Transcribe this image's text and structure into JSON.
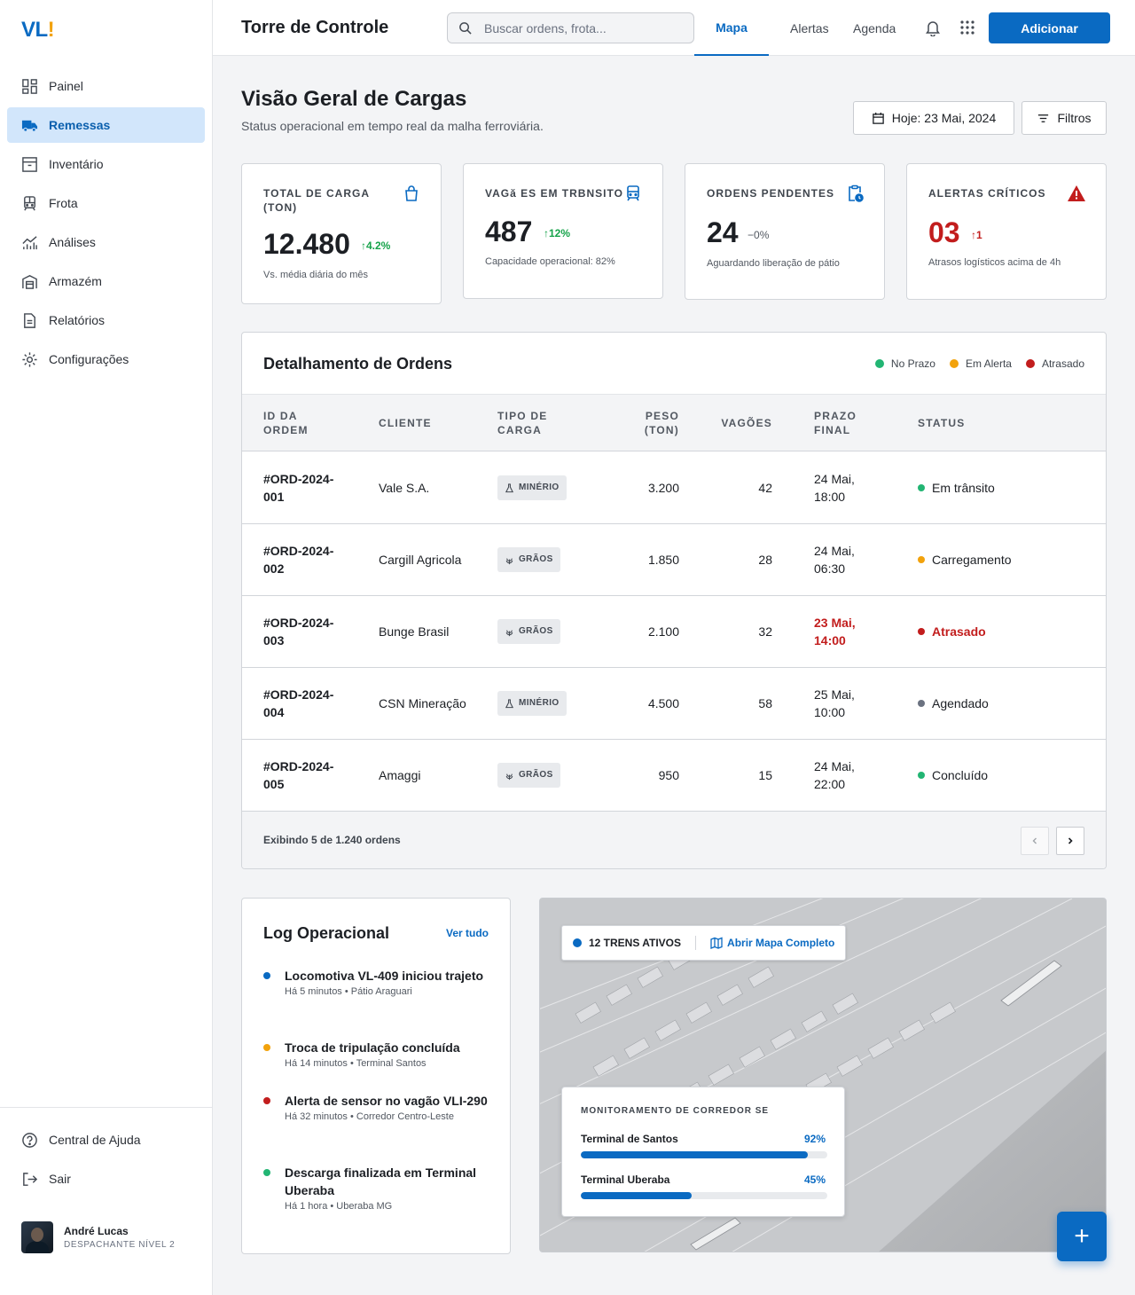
{
  "brand": {
    "logo_main": "VL",
    "logo_mark": "!"
  },
  "sidebar": {
    "items": [
      {
        "label": "Painel",
        "icon": "grid-icon",
        "active": false
      },
      {
        "label": "Remessas",
        "icon": "truck-icon",
        "active": true
      },
      {
        "label": "Inventário",
        "icon": "archive-icon",
        "active": false
      },
      {
        "label": "Frota",
        "icon": "train-icon",
        "active": false
      },
      {
        "label": "Análises",
        "icon": "analytics-icon",
        "active": false
      },
      {
        "label": "Armazém",
        "icon": "warehouse-icon",
        "active": false
      },
      {
        "label": "Relatórios",
        "icon": "report-icon",
        "active": false
      },
      {
        "label": "Configurações",
        "icon": "gear-icon",
        "active": false
      }
    ],
    "bottom": [
      {
        "label": "Central de Ajuda",
        "icon": "help-icon"
      },
      {
        "label": "Sair",
        "icon": "logout-icon"
      }
    ],
    "user": {
      "name": "André Lucas",
      "role": "DESPACHANTE NÍVEL 2"
    }
  },
  "header": {
    "title": "Torre de Controle",
    "search_placeholder": "Buscar ordens, frota...",
    "tabs": [
      {
        "label": "Mapa",
        "active": true
      },
      {
        "label": "Alertas",
        "active": false
      },
      {
        "label": "Agenda",
        "active": false
      }
    ],
    "add_label": "Adicionar"
  },
  "page": {
    "title": "Visão Geral de Cargas",
    "subtitle": "Status operacional em tempo real da malha ferroviária.",
    "date_label": "Hoje: 23 Mai, 2024",
    "filters_label": "Filtros"
  },
  "kpis": [
    {
      "label": "TOTAL DE CARGA (TON)",
      "value": "12.480",
      "delta": "4.2%",
      "delta_color": "#16a34a",
      "note": "Vs. média diária do mês",
      "icon": "bag-icon"
    },
    {
      "label": "VAGă ES EM TRBNSITO",
      "value": "487",
      "delta": "12%",
      "delta_color": "#16a34a",
      "note": "Capacidade operacional: 82%",
      "icon": "train-icon"
    },
    {
      "label": "ORDENS PENDENTES",
      "value": "24",
      "delta": "0%",
      "delta_color": "#525861",
      "note": "Aguardando liberação de pátio",
      "icon": "clipboard-clock-icon"
    },
    {
      "label": "ALERTAS CRÍTICOS",
      "value": "03",
      "delta": "1",
      "delta_color": "#c21d1d",
      "note": "Atrasos logísticos acima de 4h",
      "icon": "warning-icon"
    }
  ],
  "orders": {
    "title": "Detalhamento de Ordens",
    "legend": [
      {
        "label": "No Prazo",
        "color": "#22b573"
      },
      {
        "label": "Em Alerta",
        "color": "#f2a20c"
      },
      {
        "label": "Atrasado",
        "color": "#c21d1d"
      }
    ],
    "columns": [
      "ID DA ORDEM",
      "CLIENTE",
      "TIPO DE CARGA",
      "PESO (TON)",
      "VAGÕES",
      "PRAZO FINAL",
      "STATUS"
    ],
    "rows": [
      {
        "id": "#ORD-2024-001",
        "client": "Vale S.A.",
        "cargo": "MINÉRIO",
        "cargo_icon": "flask-icon",
        "weight": "3.200",
        "wagons": "42",
        "deadline": "24 Mai, 18:00",
        "late": false,
        "status": "Em trânsito",
        "status_color": "#22b573"
      },
      {
        "id": "#ORD-2024-002",
        "client": "Cargill Agricola",
        "cargo": "GRÃOS",
        "cargo_icon": "grain-icon",
        "weight": "1.850",
        "wagons": "28",
        "deadline": "24 Mai, 06:30",
        "late": false,
        "status": "Carregamento",
        "status_color": "#f2a20c"
      },
      {
        "id": "#ORD-2024-003",
        "client": "Bunge Brasil",
        "cargo": "GRÃOS",
        "cargo_icon": "grain-icon",
        "weight": "2.100",
        "wagons": "32",
        "deadline": "23 Mai, 14:00",
        "late": true,
        "status": "Atrasado",
        "status_color": "#c21d1d"
      },
      {
        "id": "#ORD-2024-004",
        "client": "CSN Mineração",
        "cargo": "MINÉRIO",
        "cargo_icon": "flask-icon",
        "weight": "4.500",
        "wagons": "58",
        "deadline": "25 Mai, 10:00",
        "late": false,
        "status": "Agendado",
        "status_color": "#6b7280"
      },
      {
        "id": "#ORD-2024-005",
        "client": "Amaggi",
        "cargo": "GRÃOS",
        "cargo_icon": "grain-icon",
        "weight": "950",
        "wagons": "15",
        "deadline": "24 Mai, 22:00",
        "late": false,
        "status": "Concluído",
        "status_color": "#22b573"
      }
    ],
    "footer": "Exibindo 5 de 1.240 ordens"
  },
  "log": {
    "title": "Log Operacional",
    "link": "Ver tudo",
    "items": [
      {
        "text": "Locomotiva VL-409 iniciou trajeto",
        "meta": "Há 5 minutos • Pátio Araguari",
        "color": "#0a6ac2"
      },
      {
        "text": "Troca de tripulação concluída",
        "meta": "Há 14 minutos • Terminal Santos",
        "color": "#f2a20c"
      },
      {
        "text": "Alerta de sensor no vagão VLI-290",
        "meta": "Há 32 minutos • Corredor Centro-Leste",
        "color": "#c21d1d"
      },
      {
        "text": "Descarga finalizada em Terminal Uberaba",
        "meta": "Há 1 hora • Uberaba MG",
        "color": "#22b573"
      }
    ]
  },
  "map": {
    "active_trains": "12 TRENS ATIVOS",
    "open_map": "Abrir Mapa Completo",
    "corridor_title": "MONITORAMENTO DE CORREDOR SE",
    "bars": [
      {
        "label": "Terminal de Santos",
        "pct_label": "92%",
        "value": 0.92
      },
      {
        "label": "Terminal Uberaba",
        "pct_label": "45%",
        "value": 0.45
      }
    ]
  },
  "fab": {
    "label": "+"
  },
  "colors": {
    "accent": "#0a6ac2",
    "success": "#22b573",
    "warning": "#f2a20c",
    "danger": "#c21d1d"
  }
}
